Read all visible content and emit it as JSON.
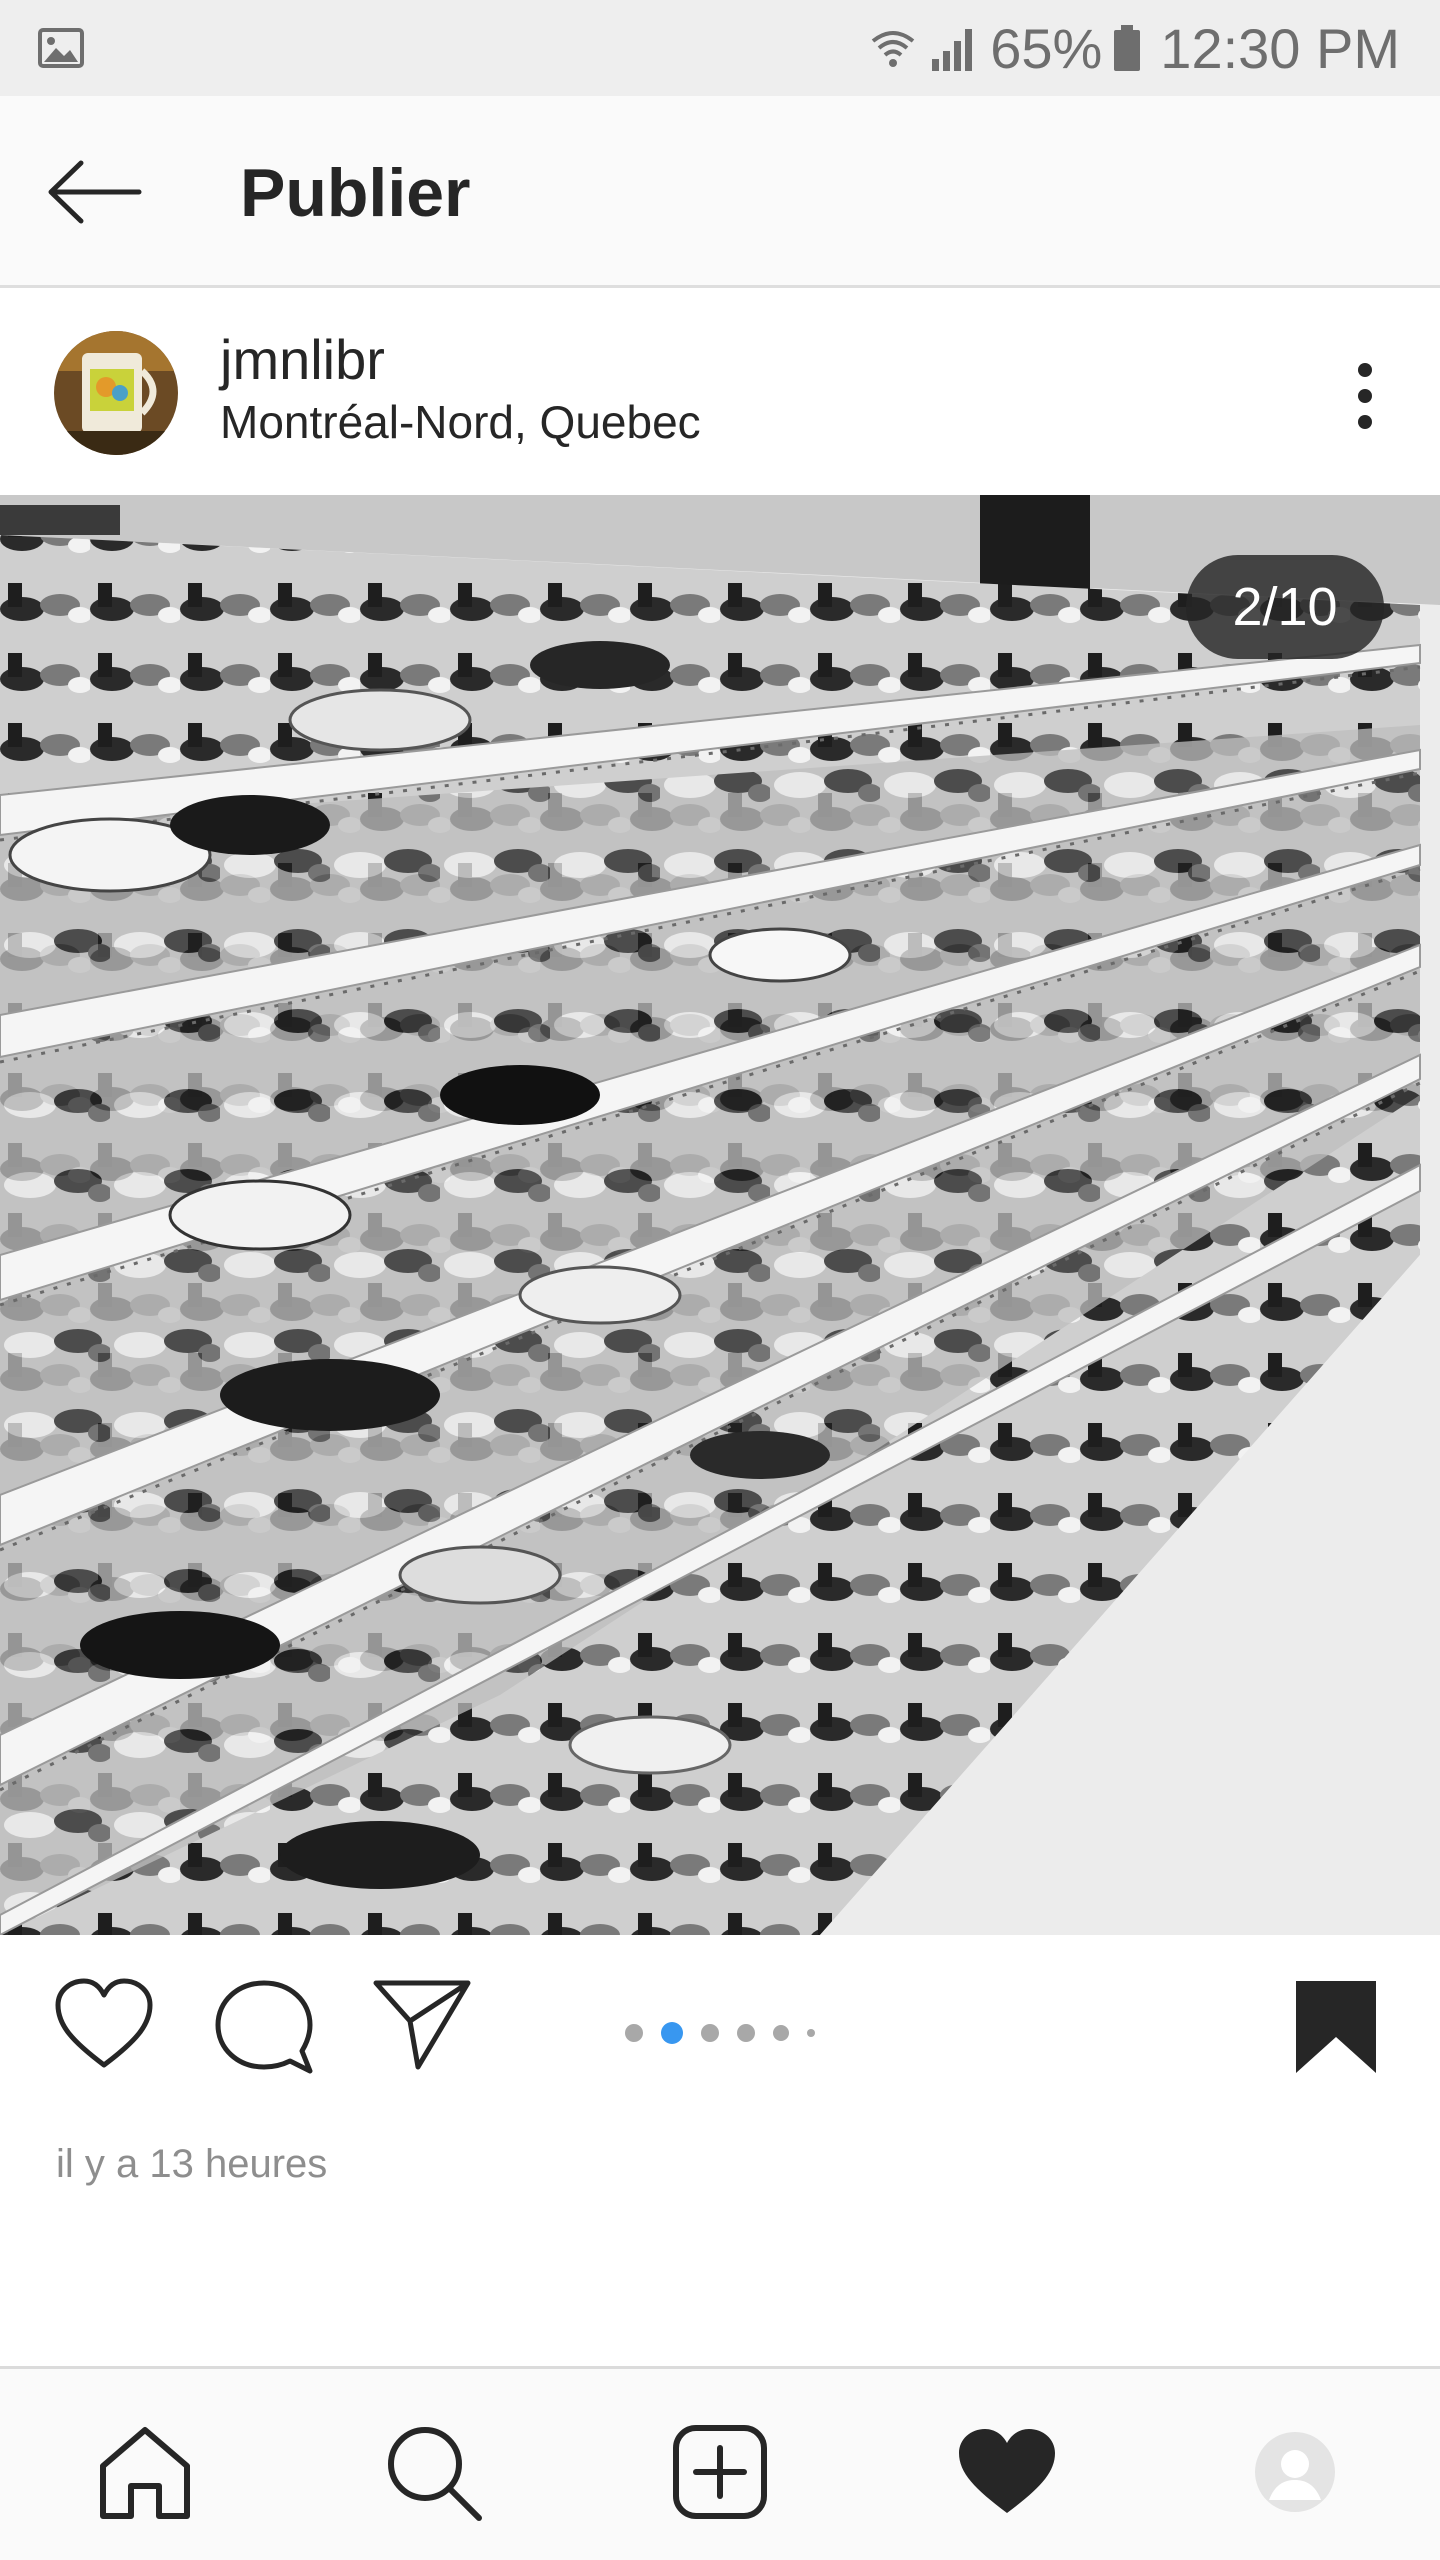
{
  "status_bar": {
    "battery": "65%",
    "time": "12:30 PM",
    "icons": [
      "gallery-icon",
      "wifi-icon",
      "signal-icon",
      "battery-icon"
    ]
  },
  "header": {
    "title": "Publier",
    "back_icon": "arrow-left-icon"
  },
  "post": {
    "username": "jmnlibr",
    "location": "Montréal-Nord, Quebec",
    "counter": "2/10",
    "timestamp": "il y a 13 heures",
    "carousel": {
      "total_indicators": 6,
      "active_index": 1
    },
    "saved": true,
    "photo_description_icon": "photo"
  },
  "actions": [
    "heart-icon",
    "comment-icon",
    "share-icon",
    "bookmark-icon"
  ],
  "bottom_nav": {
    "items": [
      "home-icon",
      "search-icon",
      "add-post-icon",
      "activity-heart-icon",
      "profile-icon"
    ],
    "active": "activity-heart-icon"
  },
  "colors": {
    "accent": "#3897f0",
    "text": "#262626",
    "muted": "#8e8e8e",
    "status_bar_bg": "#eeeeee"
  }
}
